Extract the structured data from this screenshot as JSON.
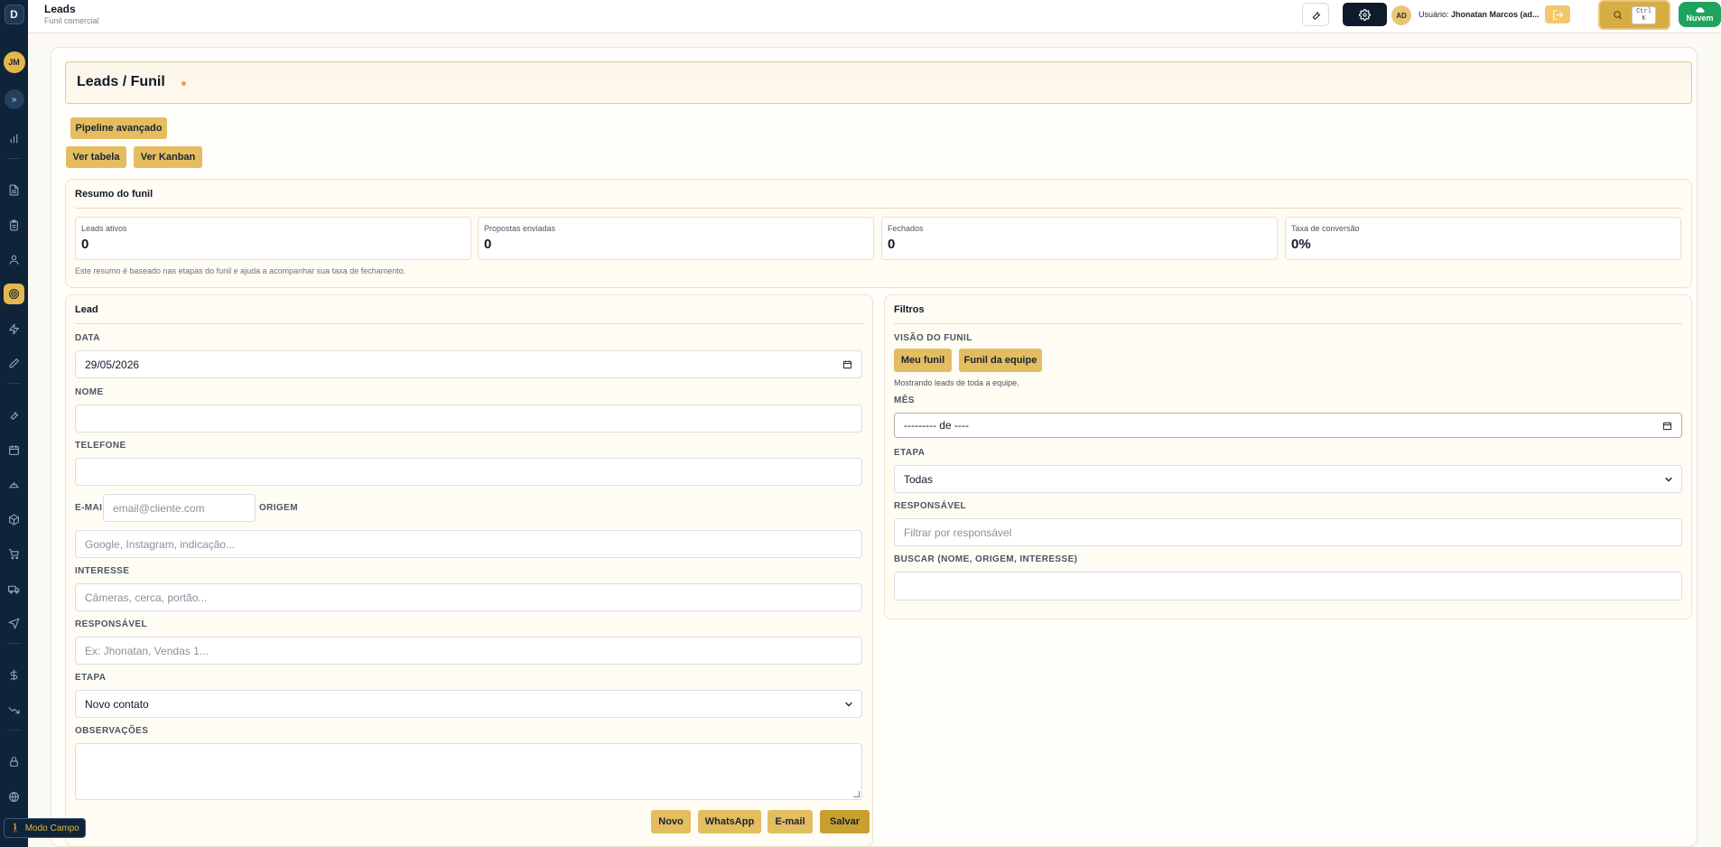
{
  "topbar": {
    "title": "Leads",
    "subtitle": "Funil comercial",
    "avatar_initials": "AD",
    "user_prefix": "Usuário:",
    "user_name": "Jhonatan Marcos (ad...",
    "search_shortcut_line1": "Ctrl",
    "search_shortcut_line2": "K",
    "cloud_label": "Nuvem"
  },
  "sidebar": {
    "logo": "D",
    "avatar_initials": "JM",
    "expand_glyph": "»",
    "icons": [
      "bar-chart-icon",
      "file-icon",
      "clipboard-icon",
      "user-icon",
      "target-icon",
      "zap-icon",
      "pencil-icon",
      "wrench-icon",
      "calendar-icon",
      "helmet-icon",
      "package-icon",
      "cart-icon",
      "truck-icon",
      "send-icon",
      "dollar-icon",
      "trending-down-icon",
      "lock-icon",
      "globe-icon"
    ],
    "active_icon": "target-icon",
    "field_mode_label": "Modo Campo"
  },
  "page": {
    "title": "Leads / Funil",
    "pipeline_button": "Pipeline avançado",
    "view_table_button": "Ver tabela",
    "view_kanban_button": "Ver Kanban"
  },
  "summary": {
    "title": "Resumo do funil",
    "stats": [
      {
        "label": "Leads ativos",
        "value": "0"
      },
      {
        "label": "Propostas enviadas",
        "value": "0"
      },
      {
        "label": "Fechados",
        "value": "0"
      },
      {
        "label": "Taxa de conversão",
        "value": "0%"
      }
    ],
    "note": "Este resumo é baseado nas etapas do funil e ajuda a acompanhar sua taxa de fechamento."
  },
  "lead_form": {
    "title": "Lead",
    "date_label": "DATA",
    "date_value": "29/05/2026",
    "name_label": "NOME",
    "name_value": "",
    "phone_label": "TELEFONE",
    "phone_value": "",
    "email_label": "E-MAIL",
    "email_placeholder": "email@cliente.com",
    "origin_label": "ORIGEM",
    "origin_placeholder": "Google, Instagram, indicação...",
    "interest_label": "INTERESSE",
    "interest_placeholder": "Câmeras, cerca, portão...",
    "owner_label": "RESPONSÁVEL",
    "owner_placeholder": "Ex: Jhonatan, Vendas 1...",
    "stage_label": "ETAPA",
    "stage_value": "Novo contato",
    "notes_label": "OBSERVAÇÕES",
    "notes_value": "",
    "buttons": {
      "new": "Novo",
      "whatsapp": "WhatsApp",
      "email": "E-mail",
      "save": "Salvar"
    }
  },
  "filters": {
    "title": "Filtros",
    "view_label": "VISÃO DO FUNIL",
    "my_funnel_button": "Meu funil",
    "team_funnel_button": "Funil da equipe",
    "view_hint": "Mostrando leads de toda a equipe.",
    "month_label": "MÊS",
    "month_value": "--------- de ----",
    "stage_label": "ETAPA",
    "stage_value": "Todas",
    "owner_label": "RESPONSÁVEL",
    "owner_placeholder": "Filtrar por responsável",
    "search_label": "BUSCAR (NOME, ORIGEM, INTERESSE)",
    "search_value": ""
  },
  "colors": {
    "sidebar_bg": "#0f2339",
    "accent_gold": "#e3bd60",
    "save_gold": "#c9a02f",
    "cloud_green": "#1fa45e"
  }
}
